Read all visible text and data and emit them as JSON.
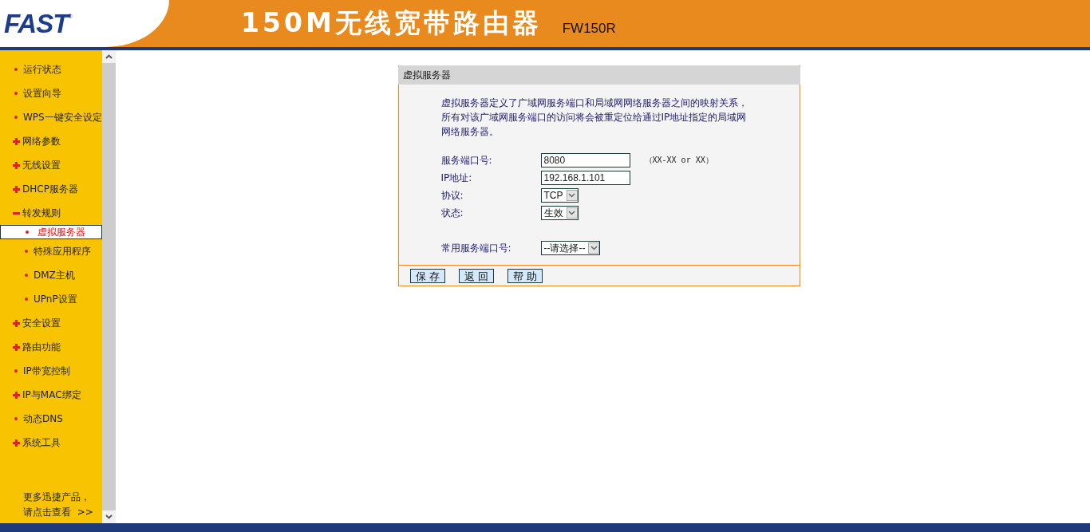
{
  "header": {
    "logo": "FAST",
    "logo_mark": "®",
    "title": "150M无线宽带路由器",
    "model": "FW150R"
  },
  "sidebar": {
    "items": [
      {
        "label": "运行状态",
        "kind": "leaf"
      },
      {
        "label": "设置向导",
        "kind": "leaf"
      },
      {
        "label": "WPS一键安全设定",
        "kind": "leaf"
      },
      {
        "label": "网络参数",
        "kind": "group",
        "expanded": false
      },
      {
        "label": "无线设置",
        "kind": "group",
        "expanded": false
      },
      {
        "label": "DHCP服务器",
        "kind": "group",
        "expanded": false
      },
      {
        "label": "转发规则",
        "kind": "group",
        "expanded": true,
        "children": [
          {
            "label": "虚拟服务器",
            "selected": true
          },
          {
            "label": "特殊应用程序",
            "selected": false
          },
          {
            "label": "DMZ主机",
            "selected": false
          },
          {
            "label": "UPnP设置",
            "selected": false
          }
        ]
      },
      {
        "label": "安全设置",
        "kind": "group",
        "expanded": false
      },
      {
        "label": "路由功能",
        "kind": "group",
        "expanded": false
      },
      {
        "label": "IP带宽控制",
        "kind": "leaf"
      },
      {
        "label": "IP与MAC绑定",
        "kind": "group",
        "expanded": false
      },
      {
        "label": "动态DNS",
        "kind": "leaf"
      },
      {
        "label": "系统工具",
        "kind": "group",
        "expanded": false
      }
    ],
    "promo": [
      "更多迅捷产品，",
      "请点击查看"
    ],
    "promo_arrow": ">>"
  },
  "panel": {
    "title": "虚拟服务器",
    "description": "虚拟服务器定义了广域网服务端口和局域网网络服务器之间的映射关系，所有对该广域网服务端口的访问将会被重定位给通过IP地址指定的局域网网络服务器。",
    "fields": [
      {
        "label": "服务端口号:",
        "kind": "input",
        "value": "8080",
        "hint": "（XX-XX or XX）"
      },
      {
        "label": "IP地址:",
        "kind": "input",
        "value": "192.168.1.101"
      },
      {
        "label": "协议:",
        "kind": "select",
        "value": "TCP"
      },
      {
        "label": "状态:",
        "kind": "select",
        "value": "生效"
      }
    ],
    "common_port": {
      "label": "常用服务端口号:",
      "value": "--请选择--"
    },
    "buttons": [
      "保 存",
      "返 回",
      "帮 助"
    ]
  }
}
